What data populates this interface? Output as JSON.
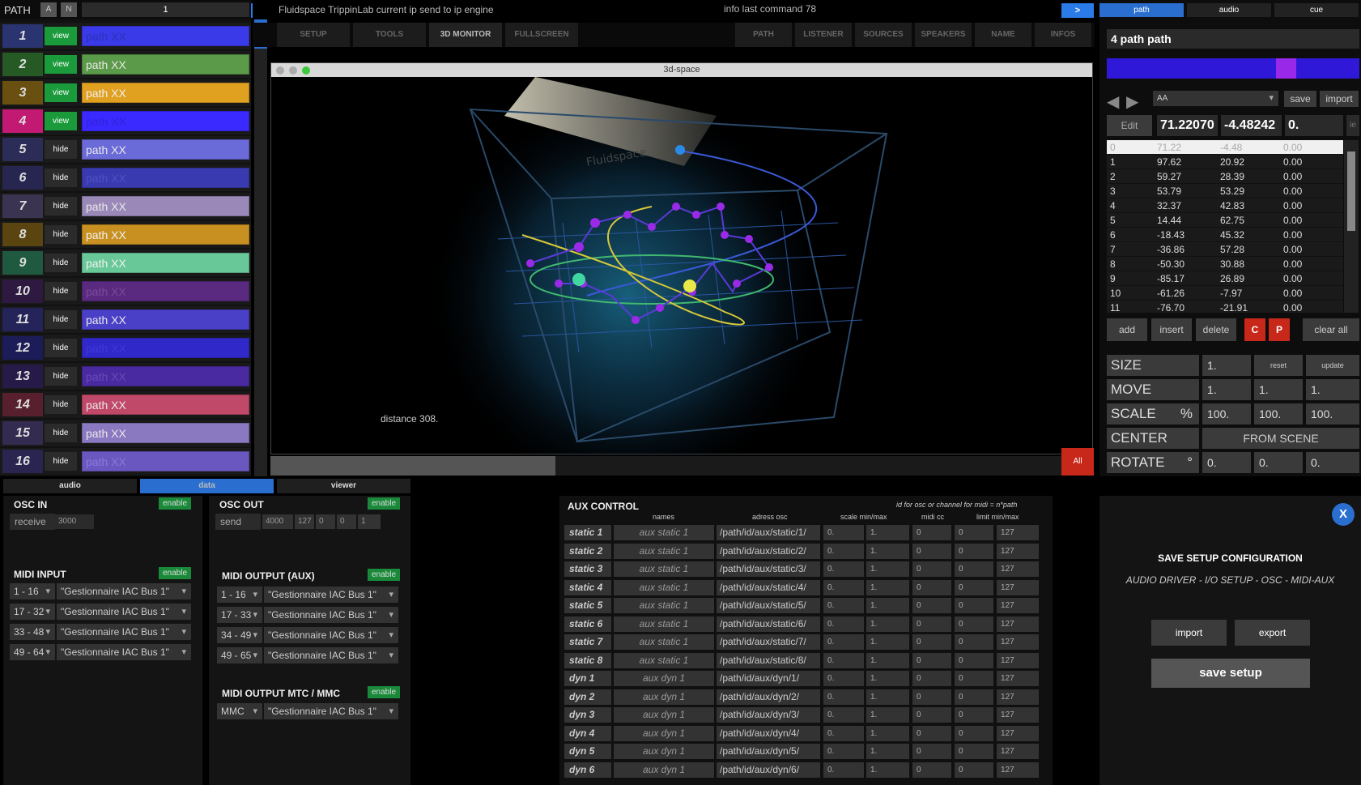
{
  "left": {
    "title": "PATH",
    "btn_a": "A",
    "btn_n": "N",
    "selected_number": "1",
    "arrow": ">",
    "paths": [
      {
        "num": "1",
        "btn": "view",
        "name": "path XX",
        "color": "#3a3ae8",
        "btncolor": "#1a9a3a",
        "numbg": "#2a3470",
        "text": "#2a32b8"
      },
      {
        "num": "2",
        "btn": "view",
        "name": "path XX",
        "color": "#5a9a48",
        "btncolor": "#1a9a3a",
        "numbg": "#255a25",
        "text": "#e8e8e8"
      },
      {
        "num": "3",
        "btn": "view",
        "name": "path XX",
        "color": "#e0a020",
        "btncolor": "#1a9a3a",
        "numbg": "#6a5010",
        "text": "#f0f0f0"
      },
      {
        "num": "4",
        "btn": "view",
        "name": "path XX",
        "color": "#3a2aff",
        "btncolor": "#1a9a3a",
        "numbg": "#c21a72",
        "text": "#3322d8"
      },
      {
        "num": "5",
        "btn": "hide",
        "name": "path XX",
        "color": "#6a6ad8",
        "btncolor": "#2b2b2b",
        "numbg": "#2c2c58",
        "text": "#e8e8e8"
      },
      {
        "num": "6",
        "btn": "hide",
        "name": "path XX",
        "color": "#3a3ab0",
        "btncolor": "#2b2b2b",
        "numbg": "#262650",
        "text": "#5050c0"
      },
      {
        "num": "7",
        "btn": "hide",
        "name": "path XX",
        "color": "#9a88b8",
        "btncolor": "#2b2b2b",
        "numbg": "#3a3450",
        "text": "#e8e8e8"
      },
      {
        "num": "8",
        "btn": "hide",
        "name": "path XX",
        "color": "#c89020",
        "btncolor": "#2b2b2b",
        "numbg": "#5a4410",
        "text": "#f0f0f0"
      },
      {
        "num": "9",
        "btn": "hide",
        "name": "path XX",
        "color": "#68c898",
        "btncolor": "#2b2b2b",
        "numbg": "#1f5a40",
        "text": "#f0f0f0"
      },
      {
        "num": "10",
        "btn": "hide",
        "name": "path XX",
        "color": "#5a2a80",
        "btncolor": "#2b2b2b",
        "numbg": "#2e1a40",
        "text": "#7a4a9a"
      },
      {
        "num": "11",
        "btn": "hide",
        "name": "path XX",
        "color": "#4a40c8",
        "btncolor": "#2b2b2b",
        "numbg": "#24245a",
        "text": "#e8e8e8"
      },
      {
        "num": "12",
        "btn": "hide",
        "name": "path XX",
        "color": "#3028c8",
        "btncolor": "#2b2b2b",
        "numbg": "#1c1c58",
        "text": "#4038d8"
      },
      {
        "num": "13",
        "btn": "hide",
        "name": "path XX",
        "color": "#4a2aa0",
        "btncolor": "#2b2b2b",
        "numbg": "#261a48",
        "text": "#6a4ab8"
      },
      {
        "num": "14",
        "btn": "hide",
        "name": "path XX",
        "color": "#c04868",
        "btncolor": "#2b2b2b",
        "numbg": "#58202e",
        "text": "#e8e8e8"
      },
      {
        "num": "15",
        "btn": "hide",
        "name": "path XX",
        "color": "#8a78c0",
        "btncolor": "#2b2b2b",
        "numbg": "#342c50",
        "text": "#e8e8e8"
      },
      {
        "num": "16",
        "btn": "hide",
        "name": "path XX",
        "color": "#6a58c0",
        "btncolor": "#2b2b2b",
        "numbg": "#2a2450",
        "text": "#8a78d8"
      }
    ]
  },
  "topbar": {
    "status": "Fluidspace TrippinLab current ip send to ip engine",
    "info": "info last command 78",
    "arrow": ">"
  },
  "toolbar": {
    "left": [
      "SETUP",
      "TOOLS",
      "3D MONITOR",
      "FULLSCREEN"
    ],
    "right": [
      "PATH",
      "LISTENER",
      "SOURCES",
      "SPEAKERS",
      "NAME",
      "INFOS"
    ]
  },
  "viewer": {
    "title": "3d-space",
    "distance": "distance 308.",
    "logo_text": "Fluidspace",
    "all_btn": "All"
  },
  "right": {
    "tabs": [
      "path",
      "audio",
      "cue"
    ],
    "path_name": "4 path path",
    "preset": "AA",
    "save": "save",
    "import": "import",
    "edit": "Edit",
    "x": "71.22070",
    "y": "-4.48242",
    "z": "0.",
    "ie": "ie",
    "rows": [
      {
        "i": "0",
        "x": "71.22",
        "y": "-4.48",
        "z": "0.00"
      },
      {
        "i": "1",
        "x": "97.62",
        "y": "20.92",
        "z": "0.00"
      },
      {
        "i": "2",
        "x": "59.27",
        "y": "28.39",
        "z": "0.00"
      },
      {
        "i": "3",
        "x": "53.79",
        "y": "53.29",
        "z": "0.00"
      },
      {
        "i": "4",
        "x": "32.37",
        "y": "42.83",
        "z": "0.00"
      },
      {
        "i": "5",
        "x": "14.44",
        "y": "62.75",
        "z": "0.00"
      },
      {
        "i": "6",
        "x": "-18.43",
        "y": "45.32",
        "z": "0.00"
      },
      {
        "i": "7",
        "x": "-36.86",
        "y": "57.28",
        "z": "0.00"
      },
      {
        "i": "8",
        "x": "-50.30",
        "y": "30.88",
        "z": "0.00"
      },
      {
        "i": "9",
        "x": "-85.17",
        "y": "26.89",
        "z": "0.00"
      },
      {
        "i": "10",
        "x": "-61.26",
        "y": "-7.97",
        "z": "0.00"
      },
      {
        "i": "11",
        "x": "-76.70",
        "y": "-21.91",
        "z": "0.00"
      }
    ],
    "add": "add",
    "insert": "insert",
    "delete": "delete",
    "c": "C",
    "p": "P",
    "clear_all": "clear all",
    "size_label": "SIZE",
    "size_val": "1.",
    "reset": "reset",
    "update": "update",
    "move_label": "MOVE",
    "move_vals": [
      "1.",
      "1.",
      "1."
    ],
    "scale_label": "SCALE",
    "scale_pct": "%",
    "scale_vals": [
      "100.",
      "100.",
      "100."
    ],
    "center_label": "CENTER",
    "from_scene": "FROM SCENE",
    "rotate_label": "ROTATE",
    "rotate_deg": "°",
    "rotate_vals": [
      "0.",
      "0.",
      "0."
    ]
  },
  "bottom_tabs": [
    "audio",
    "data",
    "viewer"
  ],
  "osc_in": {
    "title": "OSC IN",
    "enable": "enable",
    "label": "receive",
    "port": "3000"
  },
  "osc_out": {
    "title": "OSC  OUT",
    "enable": "enable",
    "label": "send",
    "port": "4000",
    "a": "127",
    "b": "0",
    "c": "0",
    "d": "1"
  },
  "midi_in": {
    "title": "MIDI INPUT",
    "enable": "enable",
    "rows": [
      {
        "range": "1 - 16",
        "dev": "\"Gestionnaire IAC Bus 1\""
      },
      {
        "range": "17 - 32",
        "dev": "\"Gestionnaire IAC Bus 1\""
      },
      {
        "range": "33 - 48",
        "dev": "\"Gestionnaire IAC Bus 1\""
      },
      {
        "range": "49 - 64",
        "dev": "\"Gestionnaire IAC Bus 1\""
      }
    ]
  },
  "midi_out": {
    "title": "MIDI OUTPUT  (AUX)",
    "enable": "enable",
    "rows": [
      {
        "range": "1 - 16",
        "dev": "\"Gestionnaire IAC Bus 1\""
      },
      {
        "range": "17 - 33",
        "dev": "\"Gestionnaire IAC Bus 1\""
      },
      {
        "range": "34 - 49",
        "dev": "\"Gestionnaire IAC Bus 1\""
      },
      {
        "range": "49 - 65",
        "dev": "\"Gestionnaire IAC Bus 1\""
      }
    ]
  },
  "midi_mtc": {
    "title": "MIDI OUTPUT MTC / MMC",
    "enable": "enable",
    "range": "MMC",
    "dev": "\"Gestionnaire IAC Bus 1\""
  },
  "aux": {
    "title": "AUX CONTROL",
    "note": "id for osc or channel for midi = n*path",
    "cols": [
      "names",
      "adress osc",
      "scale min/max",
      "midi cc",
      "limit  min/max"
    ],
    "rows": [
      {
        "id": "static 1",
        "name": "aux static 1",
        "osc": "/path/id/aux/static/1/",
        "s1": "0.",
        "s2": "1.",
        "cc": "0",
        "l1": "0",
        "l2": "127"
      },
      {
        "id": "static 2",
        "name": "aux static 1",
        "osc": "/path/id/aux/static/2/",
        "s1": "0.",
        "s2": "1.",
        "cc": "0",
        "l1": "0",
        "l2": "127"
      },
      {
        "id": "static 3",
        "name": "aux static 1",
        "osc": "/path/id/aux/static/3/",
        "s1": "0.",
        "s2": "1.",
        "cc": "0",
        "l1": "0",
        "l2": "127"
      },
      {
        "id": "static 4",
        "name": "aux static 1",
        "osc": "/path/id/aux/static/4/",
        "s1": "0.",
        "s2": "1.",
        "cc": "0",
        "l1": "0",
        "l2": "127"
      },
      {
        "id": "static 5",
        "name": "aux static 1",
        "osc": "/path/id/aux/static/5/",
        "s1": "0.",
        "s2": "1.",
        "cc": "0",
        "l1": "0",
        "l2": "127"
      },
      {
        "id": "static 6",
        "name": "aux static 1",
        "osc": "/path/id/aux/static/6/",
        "s1": "0.",
        "s2": "1.",
        "cc": "0",
        "l1": "0",
        "l2": "127"
      },
      {
        "id": "static 7",
        "name": "aux static 1",
        "osc": "/path/id/aux/static/7/",
        "s1": "0.",
        "s2": "1.",
        "cc": "0",
        "l1": "0",
        "l2": "127"
      },
      {
        "id": "static 8",
        "name": "aux static 1",
        "osc": "/path/id/aux/static/8/",
        "s1": "0.",
        "s2": "1.",
        "cc": "0",
        "l1": "0",
        "l2": "127"
      },
      {
        "id": "dyn 1",
        "name": "aux dyn 1",
        "osc": "/path/id/aux/dyn/1/",
        "s1": "0.",
        "s2": "1.",
        "cc": "0",
        "l1": "0",
        "l2": "127"
      },
      {
        "id": "dyn 2",
        "name": "aux dyn 1",
        "osc": "/path/id/aux/dyn/2/",
        "s1": "0.",
        "s2": "1.",
        "cc": "0",
        "l1": "0",
        "l2": "127"
      },
      {
        "id": "dyn 3",
        "name": "aux dyn 1",
        "osc": "/path/id/aux/dyn/3/",
        "s1": "0.",
        "s2": "1.",
        "cc": "0",
        "l1": "0",
        "l2": "127"
      },
      {
        "id": "dyn 4",
        "name": "aux dyn 1",
        "osc": "/path/id/aux/dyn/4/",
        "s1": "0.",
        "s2": "1.",
        "cc": "0",
        "l1": "0",
        "l2": "127"
      },
      {
        "id": "dyn 5",
        "name": "aux dyn 1",
        "osc": "/path/id/aux/dyn/5/",
        "s1": "0.",
        "s2": "1.",
        "cc": "0",
        "l1": "0",
        "l2": "127"
      },
      {
        "id": "dyn 6",
        "name": "aux dyn 1",
        "osc": "/path/id/aux/dyn/6/",
        "s1": "0.",
        "s2": "1.",
        "cc": "0",
        "l1": "0",
        "l2": "127"
      }
    ]
  },
  "save_panel": {
    "close": "X",
    "title": "SAVE  SETUP CONFIGURATION",
    "subtitle": "AUDIO DRIVER - I/O SETUP - OSC - MIDI-AUX",
    "import": "import",
    "export": "export",
    "save": "save setup"
  }
}
